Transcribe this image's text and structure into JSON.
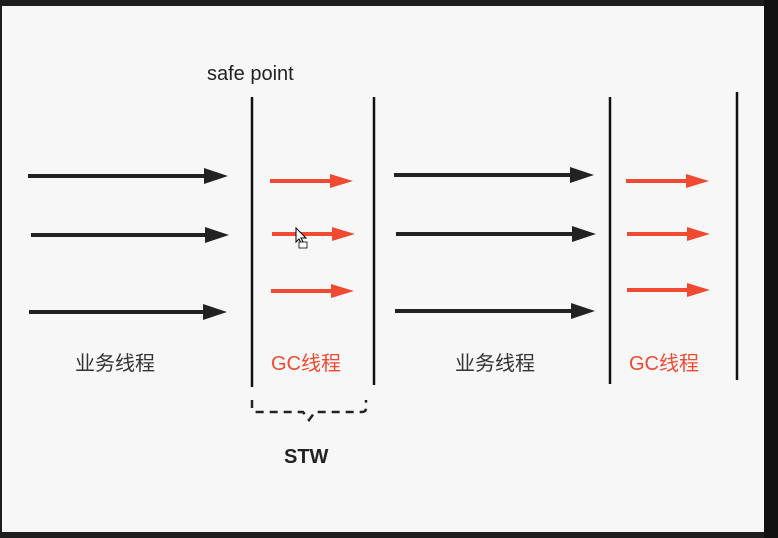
{
  "diagram": {
    "safe_point_label": "safe point",
    "business_label_1": "业务线程",
    "gc_label_1": "GC线程",
    "business_label_2": "业务线程",
    "gc_label_2": "GC线程",
    "stw_label": "STW",
    "colors": {
      "business_arrow": "#222222",
      "gc_arrow": "#f04a32",
      "gc_text": "#f04a32",
      "business_text": "#333333",
      "divider": "#111111",
      "background": "#f7f7f7"
    }
  }
}
